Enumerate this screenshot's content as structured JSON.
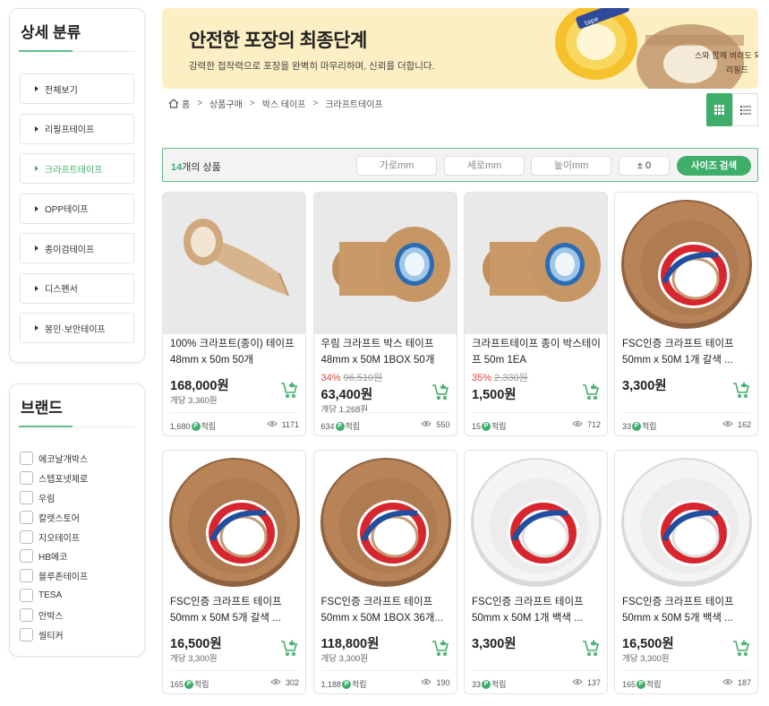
{
  "sidebar": {
    "category_title": "상세 분류",
    "categories": [
      "전체보기",
      "리필프테이프",
      "크라프트테이프",
      "OPP테이프",
      "종이검테이프",
      "디스펜서",
      "봉인·보안테이프"
    ],
    "active_category": "크라프트테이프",
    "brand_title": "브랜드",
    "brands": [
      "에코날개박스",
      "스텝포넷제로",
      "우림",
      "칼렛스토어",
      "지오테이프",
      "HB에코",
      "블루존테이프",
      "TESA",
      "안박스",
      "씰티커"
    ]
  },
  "banner": {
    "title": "안전한 포장의 최종단계",
    "subtitle": "강력한 접착력으로 포장을 완벽히 마무리하며, 신뢰를 더합니다."
  },
  "breadcrumb": [
    "홈",
    "상품구매",
    "박스 테이프",
    "크라프트테이프"
  ],
  "filter": {
    "count": "14",
    "count_suffix": "개의 상품",
    "width_placeholder": "가로mm",
    "length_placeholder": "세로mm",
    "height_placeholder": "높이mm",
    "tolerance": "± 0",
    "search_label": "사이즈 검색"
  },
  "points_label": "적립",
  "points_icon": "P",
  "accent_color": "#3fae6b",
  "products": [
    {
      "name1": "100% 크라프트(종이) 테이프",
      "name2": "48mm x 50m 50개",
      "discount": "",
      "orig_price": "",
      "price": "168,000원",
      "unit_price": "개당 3,360원",
      "points": "1,680",
      "views": "1171",
      "image": "kraft-tape-unrolled"
    },
    {
      "name1": "우림 크라프트 박스 테이프",
      "name2": "48mm x 50M 1BOX 50개",
      "discount": "34%",
      "orig_price": "96,510원",
      "price": "63,400원",
      "unit_price": "개당 1,268원",
      "points": "634",
      "views": "550",
      "image": "kraft-tape-pair"
    },
    {
      "name1": "크라프트테이프 종이 박스테이",
      "name2": "프 50m 1EA",
      "discount": "35%",
      "orig_price": "2,330원",
      "price": "1,500원",
      "unit_price": "",
      "points": "15",
      "views": "712",
      "image": "kraft-tape-pair"
    },
    {
      "name1": "FSC인증 크라프트 테이프",
      "name2": "50mm x 50M 1개 갈색 ...",
      "discount": "",
      "orig_price": "",
      "price": "3,300원",
      "unit_price": "",
      "points": "33",
      "views": "162",
      "image": "tesa-brown-roll"
    },
    {
      "name1": "FSC인증 크라프트 테이프",
      "name2": "50mm x 50M 5개 갈색 ...",
      "discount": "",
      "orig_price": "",
      "price": "16,500원",
      "unit_price": "개당 3,300원",
      "points": "165",
      "views": "302",
      "image": "tesa-brown-roll"
    },
    {
      "name1": "FSC인증 크라프트 테이프",
      "name2": "50mm x 50M 1BOX 36개...",
      "discount": "",
      "orig_price": "",
      "price": "118,800원",
      "unit_price": "개당 3,300원",
      "points": "1,188",
      "views": "190",
      "image": "tesa-brown-roll"
    },
    {
      "name1": "FSC인증 크라프트 테이프",
      "name2": "50mm x 50M 1개 백색 ...",
      "discount": "",
      "orig_price": "",
      "price": "3,300원",
      "unit_price": "",
      "points": "33",
      "views": "137",
      "image": "tesa-white-roll"
    },
    {
      "name1": "FSC인증 크라프트 테이프",
      "name2": "50mm x 50M 5개 백색 ...",
      "discount": "",
      "orig_price": "",
      "price": "16,500원",
      "unit_price": "개당 3,300원",
      "points": "165",
      "views": "187",
      "image": "tesa-white-roll"
    }
  ]
}
